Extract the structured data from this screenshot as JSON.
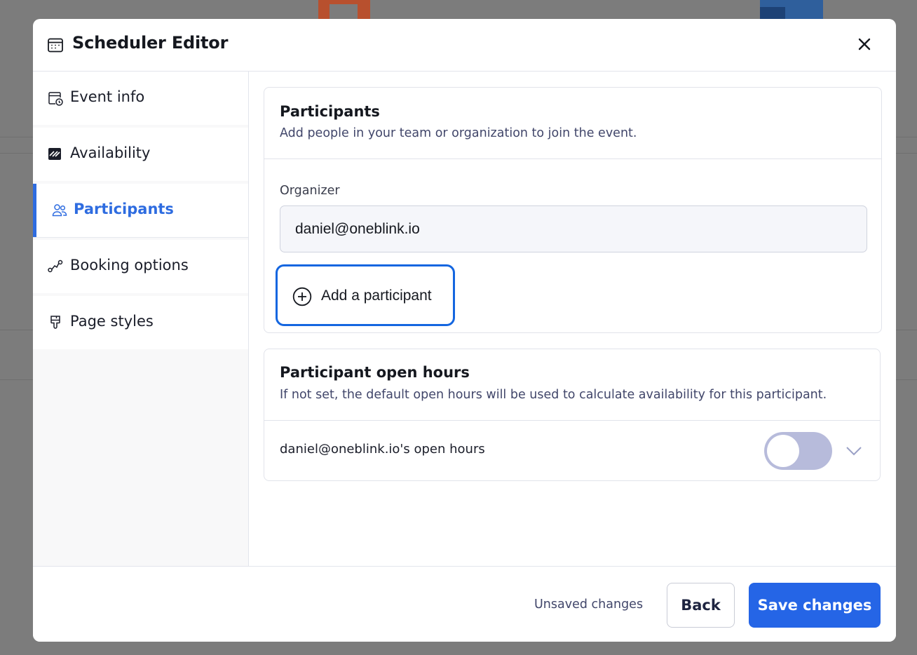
{
  "modal": {
    "title": "Scheduler Editor",
    "close_icon": "close-icon",
    "title_icon": "calendar-icon"
  },
  "sidebar": {
    "items": [
      {
        "label": "Event info",
        "icon": "calendar-clock-icon",
        "active": false
      },
      {
        "label": "Availability",
        "icon": "availability-icon",
        "active": false
      },
      {
        "label": "Participants",
        "icon": "users-icon",
        "active": true
      },
      {
        "label": "Booking options",
        "icon": "route-icon",
        "active": false
      },
      {
        "label": "Page styles",
        "icon": "paintbrush-icon",
        "active": false
      }
    ]
  },
  "participants": {
    "title": "Participants",
    "subtitle": "Add people in your team or organization to join the event.",
    "organizer_label": "Organizer",
    "organizer_value": "daniel@oneblink.io",
    "add_button_label": "Add a participant"
  },
  "open_hours": {
    "title": "Participant open hours",
    "subtitle": "If not set, the default open hours will be used to calculate availability for this participant.",
    "row_label": "daniel@oneblink.io's open hours",
    "toggle_on": false
  },
  "footer": {
    "status": "Unsaved changes",
    "back_label": "Back",
    "save_label": "Save changes"
  },
  "colors": {
    "accent": "#2565e6",
    "focus_ring": "#1466e0",
    "toggle_off": "#b7bbdb",
    "overlay": "#7c7c7c"
  }
}
